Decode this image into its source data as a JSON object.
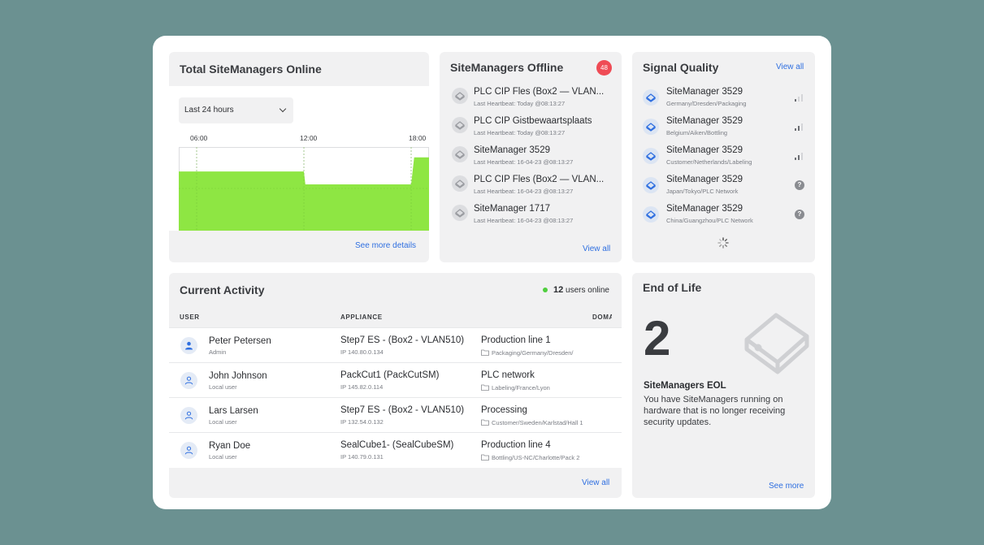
{
  "online_card": {
    "title": "Total SiteManagers Online",
    "range_select": "Last 24 hours",
    "ticks": [
      "06:00",
      "12:00",
      "18:00"
    ],
    "link": "See more details"
  },
  "chart_data": {
    "type": "area",
    "x": [
      "05:00",
      "12:00",
      "12:05",
      "18:00",
      "18:10",
      "19:00"
    ],
    "values": [
      46,
      46,
      36,
      36,
      57,
      57
    ],
    "ylim": [
      0,
      65
    ],
    "color": "#8ee643",
    "x_tick_labels": [
      "06:00",
      "12:00",
      "18:00"
    ],
    "grid": true
  },
  "offline_card": {
    "title": "SiteManagers Offline",
    "count": "48",
    "items": [
      {
        "name": "PLC CIP Fles (Box2 — VLAN...",
        "sub": "Last Heartbeat: Today @08:13:27"
      },
      {
        "name": "PLC CIP Gistbewaartsplaats",
        "sub": "Last Heartbeat: Today @08:13:27"
      },
      {
        "name": "SiteManager 3529",
        "sub": "Last Heartbeat: 16-04-23 @08:13:27"
      },
      {
        "name": "PLC CIP Fles (Box2 — VLAN...",
        "sub": "Last Heartbeat: 16-04-23 @08:13:27"
      },
      {
        "name": "SiteManager 1717",
        "sub": "Last Heartbeat: 16-04-23 @08:13:27"
      }
    ],
    "link": "View all"
  },
  "signal_card": {
    "title": "Signal Quality",
    "link": "View all",
    "items": [
      {
        "name": "SiteManager 3529",
        "sub": "Germany/Dresden/Packaging",
        "signal": "1 of 3 bars"
      },
      {
        "name": "SiteManager 3529",
        "sub": "Belgium/Aiken/Bottling",
        "signal": "2 of 3 bars"
      },
      {
        "name": "SiteManager 3529",
        "sub": "Customer/Netherlands/Labeling",
        "signal": "2 of 3 bars"
      },
      {
        "name": "SiteManager 3529",
        "sub": "Japan/Tokyo/PLC Network",
        "signal": "unknown"
      },
      {
        "name": "SiteManager 3529",
        "sub": "China/Guangzhou/PLC Network",
        "signal": "unknown"
      }
    ],
    "unknown_icon": "?"
  },
  "activity_card": {
    "title": "Current Activity",
    "online_count": "12",
    "online_label": "users online",
    "columns": [
      "USER",
      "APPLIANCE",
      "DOMA"
    ],
    "rows": [
      {
        "user": "Peter Petersen",
        "role": "Admin",
        "appliance": "Step7 ES - (Box2 - VLAN510)",
        "ip": "IP   140.80.0.134",
        "domain": "Production line 1",
        "path": "Packaging/Germany/Dresden/"
      },
      {
        "user": "John Johnson",
        "role": "Local user",
        "appliance": "PackCut1 (PackCutSM)",
        "ip": "IP   145.82.0.114",
        "domain": "PLC network",
        "path": "Labeling/France/Lyon"
      },
      {
        "user": "Lars Larsen",
        "role": "Local user",
        "appliance": "Step7 ES - (Box2 - VLAN510)",
        "ip": "IP   132.54.0.132",
        "domain": "Processing",
        "path": "Customer/Sweden/Karlstad/Hall 1"
      },
      {
        "user": "Ryan Doe",
        "role": "Local user",
        "appliance": "SealCube1- (SealCubeSM)",
        "ip": "IP   140.79.0.131",
        "domain": "Production line 4",
        "path": "Bottling/US-NC/Charlotte/Pack 2"
      }
    ],
    "link": "View all"
  },
  "eol_card": {
    "title": "End of Life",
    "count": "2",
    "subtitle": "SiteManagers EOL",
    "description": "You have SiteManagers running on hardware that is no longer receiving security updates.",
    "link": "See more"
  },
  "colors": {
    "background": "#6b9191",
    "card": "#f1f1f2",
    "accent": "#2f6fe0",
    "badge": "#ef4b55",
    "online": "#4fce3e",
    "chart_fill": "#8ee643"
  }
}
